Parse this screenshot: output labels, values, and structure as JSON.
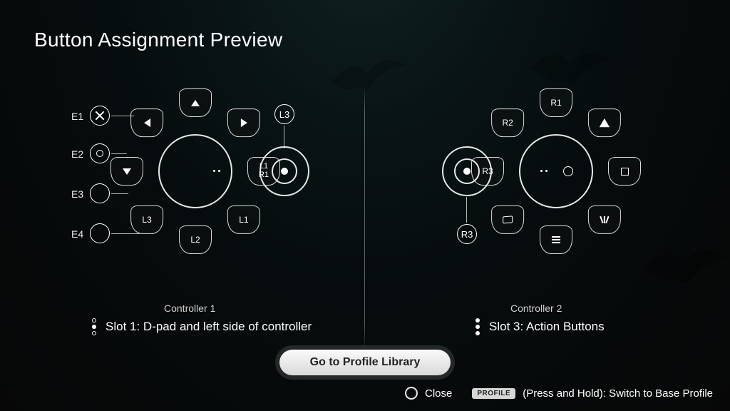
{
  "title": "Button Assignment Preview",
  "controller1": {
    "heading": "Controller 1",
    "slot_text": "Slot 1: D-pad and left side of controller",
    "expansion": {
      "e1": "E1",
      "e2": "E2",
      "e3": "E3",
      "e4": "E4"
    },
    "expansion_glyph": {
      "e1": "cross",
      "e2": "circle",
      "e3": "",
      "e4": ""
    },
    "stick_label": "L3",
    "petals": {
      "p0": {
        "type": "text",
        "label": "L1"
      },
      "p1": {
        "type": "text",
        "label": "L3"
      },
      "p2": {
        "type": "text",
        "label": "L2"
      },
      "p3": {
        "type": "arrow",
        "dir": "down"
      },
      "p4": {
        "type": "arrow",
        "dir": "left"
      },
      "p5": {
        "type": "arrow",
        "dir": "up"
      },
      "p6": {
        "type": "arrow",
        "dir": "right"
      },
      "p7": {
        "type": "stack",
        "top": "L1",
        "bottom": "R1"
      }
    }
  },
  "controller2": {
    "heading": "Controller 2",
    "slot_text": "Slot 3: Action Buttons",
    "stick_label": "R3",
    "center_glyph": "circle",
    "petals": {
      "p0": {
        "type": "glyph",
        "glyph": "square"
      },
      "p1": {
        "type": "glyph",
        "glyph": "share"
      },
      "p2": {
        "type": "glyph",
        "glyph": "menu"
      },
      "p3": {
        "type": "glyph",
        "glyph": "touchpad"
      },
      "p4": {
        "type": "text",
        "label": "R3"
      },
      "p5": {
        "type": "text",
        "label": "R2"
      },
      "p6": {
        "type": "text",
        "label": "R1"
      },
      "p7": {
        "type": "glyph",
        "glyph": "triangle"
      }
    }
  },
  "cta_label": "Go to Profile Library",
  "hints": {
    "close": "Close",
    "profile_pill": "PROFILE",
    "hold_text": "(Press and Hold): Switch to Base Profile"
  }
}
